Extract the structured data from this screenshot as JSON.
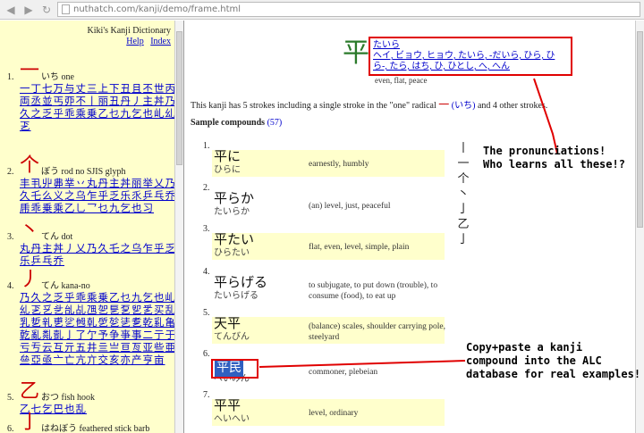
{
  "browser": {
    "url": "nuthatch.com/kanji/demo/frame.html",
    "back_icon": "arrow-left-icon",
    "forward_icon": "arrow-right-icon",
    "reload_icon": "reload-icon"
  },
  "sidebar": {
    "title": "Kiki's Kanji Dictionary",
    "help_link": "Help",
    "index_link": "Index",
    "radicals": [
      {
        "num": "1.",
        "glyph": "一",
        "reading": "いち one",
        "kanji": "一丁七万与丈三上下丑且丕世丙両丞並丐丣不丨丽丑丹丿主丼乃久之乏乎乖乘乗乙乜九乞也乢乣乤"
      },
      {
        "num": "2.",
        "glyph": "个",
        "reading": "ぼう rod no SJIS glyph",
        "kanji": "丰丮丱丳丵丷丸丹主丼丽举乂乃久乇么义之乌乍乎乏乐乑乒乓乔乕乖乗乘乙乚乛乜九乞也习"
      },
      {
        "num": "3.",
        "glyph": "丶",
        "reading": "てん dot",
        "kanji": "丸丹主丼丿乂乃久乇之乌乍乎乏乐乒乓乔"
      },
      {
        "num": "4.",
        "glyph": "丿",
        "reading": "てん kana-no",
        "kanji": "乃久之乏乎乖乘乗乙乜九乞也乢乣乤乥乧乨乩乪乫乬乭乮乯买乱乳乴乵乶乷乸乹乺乻乼乽乾乿亀亁亂亃亄亅了亇予争亊事二亍于亏亐云互亓五井亖亗亘亙亚些亜亝亞亟亠亡亢亣交亥亦产亨亩"
      },
      {
        "num": "5.",
        "glyph": "乙",
        "reading": "おつ fish hook",
        "kanji": "乙七乞巴也乱"
      },
      {
        "num": "6.",
        "glyph": "亅",
        "reading": "はねぼう feathered stick barb",
        "kanji": ""
      }
    ]
  },
  "main": {
    "kanji": "平",
    "readings_kun": "たいら",
    "readings_full": "ヘイ, ビョウ, ヒョウ, たいら, -だいら, ひら, ひら-, たら, はち, ひ, ひとし, へ, へん",
    "meaning": "even, flat, peace",
    "strokes_prefix": "This kanji has 5 strokes including a single stroke in the \"one\" radical",
    "strokes_radical": "一",
    "strokes_radical_reading": "(いち)",
    "strokes_suffix": "and 4 other strokes.",
    "compounds_label": "Sample compounds",
    "compounds_count": "(57)",
    "stroke_order": [
      "丨",
      "一",
      "个",
      "丶",
      "亅",
      "乙",
      "亅"
    ],
    "compounds": [
      {
        "num": "1.",
        "word": "平に",
        "kana": "ひらに",
        "def": "earnestly, humbly"
      },
      {
        "num": "2.",
        "word": "平らか",
        "kana": "たいらか",
        "def": "(an) level, just, peaceful"
      },
      {
        "num": "3.",
        "word": "平たい",
        "kana": "ひらたい",
        "def": "flat, even, level, simple, plain"
      },
      {
        "num": "4.",
        "word": "平らげる",
        "kana": "たいらげる",
        "def": "to subjugate, to put down (trouble), to consume (food), to eat up"
      },
      {
        "num": "5.",
        "word": "天平",
        "kana": "てんびん",
        "def": "(balance) scales, shoulder carrying pole, steelyard"
      },
      {
        "num": "6.",
        "word": "平民",
        "kana": "へいみん",
        "def": "commoner, plebeian"
      },
      {
        "num": "7.",
        "word": "平平",
        "kana": "へいへい",
        "def": "level, ordinary"
      }
    ]
  },
  "annotations": {
    "pronunciations": "The pronunciations!\nWho learns all these!?",
    "copy_paste": "Copy+paste a kanji\ncompound into the ALC\ndatabase for real examples!",
    "color": "#e00000"
  }
}
